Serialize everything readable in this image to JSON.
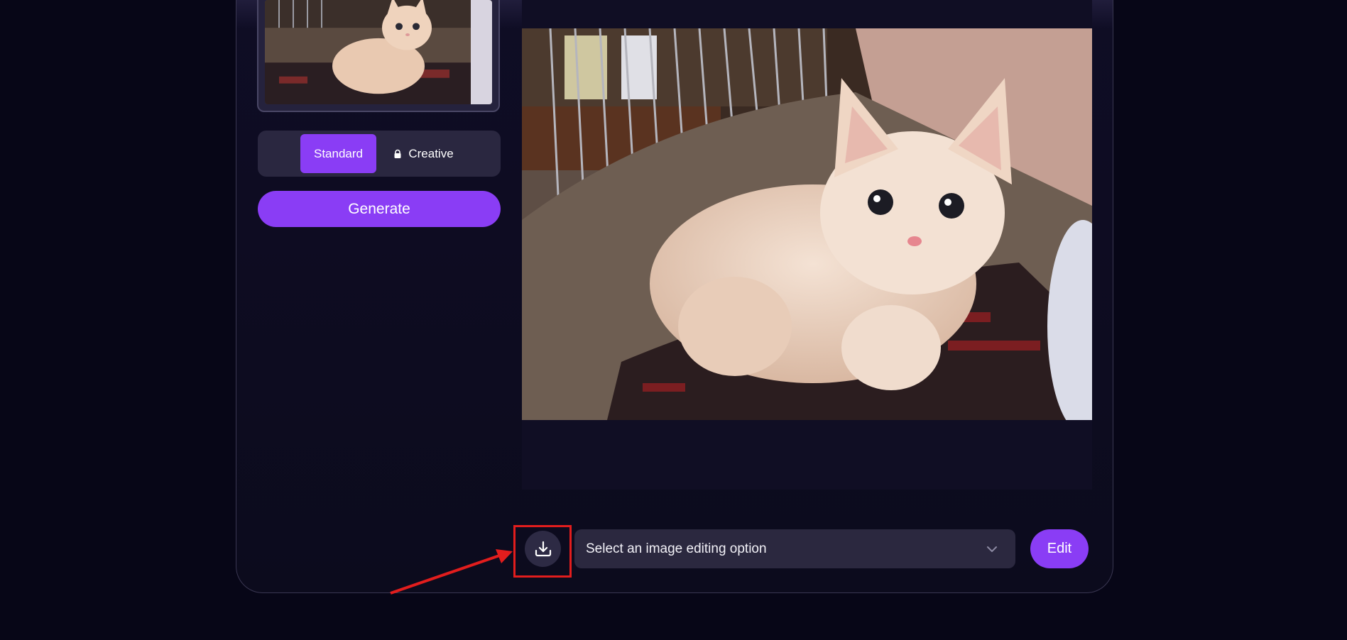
{
  "sidebar": {
    "thumbnail_alt": "Uploaded kitten photo",
    "mode_standard_label": "Standard",
    "mode_creative_label": "Creative",
    "generate_label": "Generate"
  },
  "preview": {
    "alt": "Upscaled kitten photo"
  },
  "toolbar": {
    "edit_select_placeholder": "Select an image editing option",
    "edit_label": "Edit"
  },
  "icons": {
    "download": "download-icon",
    "lock": "lock-icon",
    "chevron": "chevron-down-icon"
  },
  "colors": {
    "accent": "#8a3df5",
    "highlight": "#e21d1d",
    "background": "#070617"
  }
}
